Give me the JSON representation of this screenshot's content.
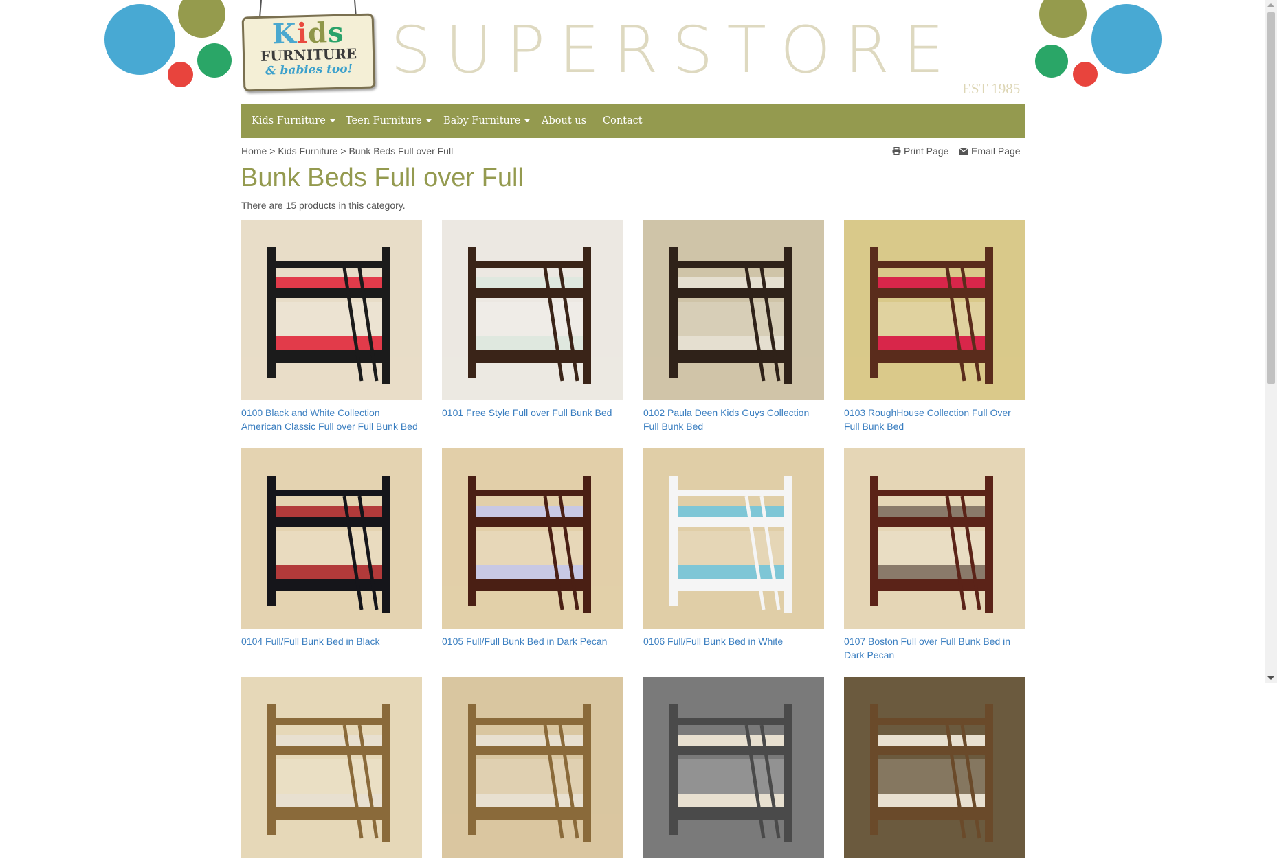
{
  "header": {
    "logo_kids_letters": [
      "K",
      "i",
      "d",
      "s"
    ],
    "logo_line2": "FURNITURE",
    "logo_line3": "& babies too!",
    "store_title": "SUPERSTORE",
    "est": "EST 1985",
    "circle_colors": {
      "blue": "#48a9d3",
      "olive": "#959b4d",
      "red": "#e8443d",
      "green": "#2aa667"
    }
  },
  "nav": {
    "items": [
      {
        "label": "Kids Furniture",
        "dropdown": true
      },
      {
        "label": "Teen Furniture",
        "dropdown": true
      },
      {
        "label": "Baby Furniture",
        "dropdown": true
      },
      {
        "label": "About us",
        "dropdown": false
      },
      {
        "label": "Contact",
        "dropdown": false
      }
    ],
    "bg_color": "#949a4f"
  },
  "breadcrumb": {
    "home": "Home",
    "sep": ">",
    "category": "Kids Furniture",
    "current": "Bunk Beds Full over Full"
  },
  "tools": {
    "print": "Print Page",
    "email": "Email Page"
  },
  "page": {
    "title": "Bunk Beds Full over Full",
    "count_text": "There are 15 products in this category."
  },
  "products": [
    {
      "name": "0100 Black and White Collection American Classic Full over Full Bunk Bed",
      "wood": "#1b1b1b",
      "bed": "#e23b4a",
      "bg": "#e8ddc8"
    },
    {
      "name": "0101 Free Style Full over Full Bunk Bed",
      "wood": "#3a2418",
      "bed": "#dfe8df",
      "bg": "#ece8e2"
    },
    {
      "name": "0102 Paula Deen Kids Guys Collection Full Bunk Bed",
      "wood": "#2f2219",
      "bed": "#e5dfd0",
      "bg": "#cfc4a8"
    },
    {
      "name": "0103 RoughHouse Collection Full Over Full Bunk Bed",
      "wood": "#5a2c1c",
      "bed": "#d8264a",
      "bg": "#d9c98a"
    },
    {
      "name": "0104 Full/Full Bunk Bed in Black",
      "wood": "#15151a",
      "bed": "#b23a3a",
      "bg": "#e4d3b1"
    },
    {
      "name": "0105 Full/Full Bunk Bed in Dark Pecan",
      "wood": "#4a1f14",
      "bed": "#c8c8e4",
      "bg": "#e2cfa9"
    },
    {
      "name": "0106 Full/Full Bunk Bed in White",
      "wood": "#f5f5f5",
      "bed": "#7ec6d6",
      "bg": "#e0cea7"
    },
    {
      "name": "0107 Boston Full over Full Bunk Bed in Dark Pecan",
      "wood": "#5b2318",
      "bed": "#8a7a6a",
      "bg": "#e5d6b6"
    },
    {
      "name": "",
      "wood": "#8a6a3a",
      "bed": "#e8e0d0",
      "bg": "#e6d8b8"
    },
    {
      "name": "",
      "wood": "#8a6a3a",
      "bed": "#e8e0d0",
      "bg": "#d9c6a0"
    },
    {
      "name": "",
      "wood": "#4a4a4a",
      "bed": "#e8e0d0",
      "bg": "#7a7a7a"
    },
    {
      "name": "",
      "wood": "#6a4a2a",
      "bed": "#e8e0d0",
      "bg": "#6b5a3e"
    }
  ]
}
